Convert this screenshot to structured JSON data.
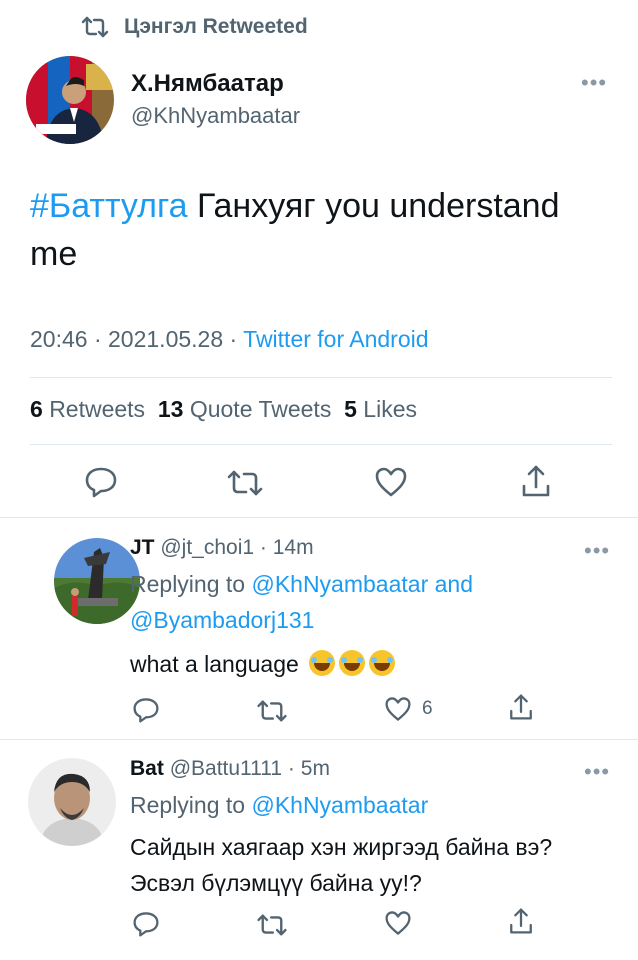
{
  "retweet_header": {
    "label": "Цэнгэл Retweeted"
  },
  "main_tweet": {
    "name": "Х.Нямбаатар",
    "handle": "@KhNyambaatar",
    "hashtag": "#Баттулга",
    "text": " Ганхуяг you understand me",
    "time": "20:46",
    "date": "2021.05.28",
    "source": "Twitter for Android",
    "separator": " · ",
    "stats": {
      "retweets_count": "6",
      "retweets_label": "Retweets",
      "quotes_count": "13",
      "quotes_label": "Quote Tweets",
      "likes_count": "5",
      "likes_label": "Likes"
    }
  },
  "replies": [
    {
      "name": "JT",
      "handle": "@jt_choi1",
      "time": "14m",
      "replying_label": "Replying to ",
      "replying_to_1": "@KhNyambaatar",
      "replying_and": " and",
      "replying_to_2": "@Byambadorj131",
      "text": "what a language",
      "like_count": "6"
    },
    {
      "name": "Bat",
      "handle": "@Battu1111",
      "time": "5m",
      "replying_label": "Replying to ",
      "replying_to_1": "@KhNyambaatar",
      "text": "Сайдын хаягаар хэн жиргээд байна вэ? Эсвэл бүлэмцүү байна уу!?"
    }
  ],
  "icons": {
    "retweet": "retweet-icon",
    "reply": "reply-icon",
    "like": "heart-icon",
    "share": "share-icon",
    "more": "more-icon"
  },
  "colors": {
    "link": "#1d9bf0",
    "secondary": "#536471",
    "divider": "#e1e8ed"
  }
}
